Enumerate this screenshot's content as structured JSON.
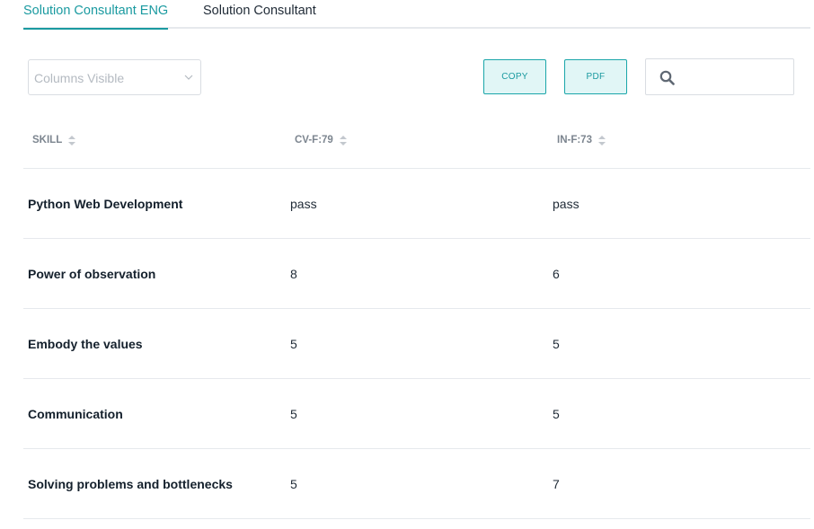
{
  "tabs": [
    {
      "label": "Solution Consultant ENG",
      "active": true
    },
    {
      "label": "Solution Consultant",
      "active": false
    }
  ],
  "toolbar": {
    "columns_placeholder": "Columns Visible",
    "copy_label": "COPY",
    "pdf_label": "PDF",
    "search_value": ""
  },
  "table": {
    "headers": [
      "SKILL",
      "CV-F:79",
      "IN-F:73"
    ],
    "rows": [
      {
        "skill": "Python Web Development",
        "cv": "pass",
        "in": "pass"
      },
      {
        "skill": "Power of observation",
        "cv": "8",
        "in": "6"
      },
      {
        "skill": "Embody the values",
        "cv": "5",
        "in": "5"
      },
      {
        "skill": "Communication",
        "cv": "5",
        "in": "5"
      },
      {
        "skill": "Solving problems and bottlenecks",
        "cv": "5",
        "in": "7"
      }
    ]
  },
  "colors": {
    "accent": "#1a9aa0",
    "button_bg": "#e1f6f6",
    "border": "#e6e9ed",
    "header_text": "#7c858f"
  },
  "icons": {
    "search": "search-icon",
    "chevron": "chevron-down-icon",
    "sort": "sort-icon"
  }
}
